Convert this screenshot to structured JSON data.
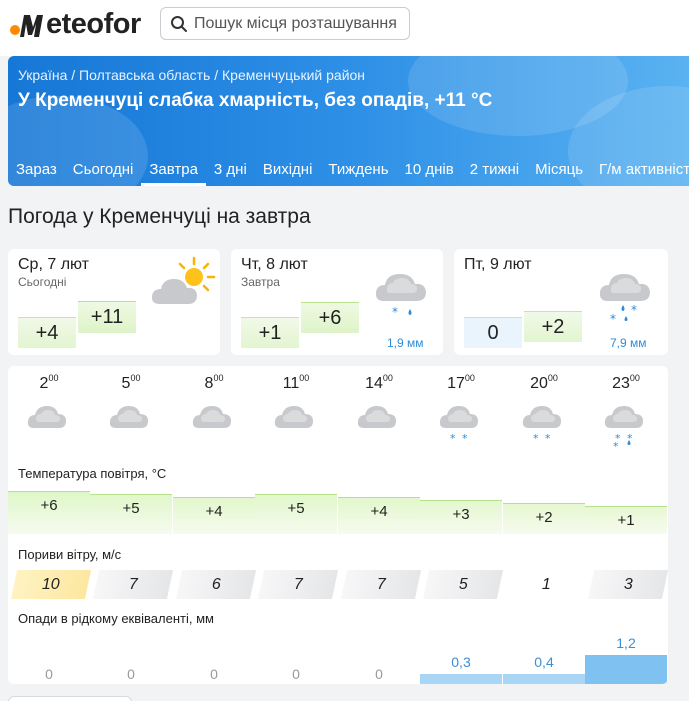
{
  "brand": {
    "name": "Meteofor",
    "logo_text": "eteofor",
    "logo_letter": "M"
  },
  "search": {
    "placeholder": "Пошук місця розташування"
  },
  "breadcrumb": [
    "Україна",
    "Полтавська область",
    "Кременчуцький район"
  ],
  "breadcrumb_sep": " / ",
  "hero_title": "У Кременчуці слабка хмарність, без опадів, +11 °C",
  "tabs": [
    "Зараз",
    "Сьогодні",
    "Завтра",
    "3 дні",
    "Вихідні",
    "Тиждень",
    "10 днів",
    "2 тижні",
    "Місяць",
    "Г/м активність"
  ],
  "active_tab": "Завтра",
  "page_title": "Погода у Кременчуці на завтра",
  "days": [
    {
      "date": "Ср, 7 лют",
      "sub": "Сьогодні",
      "min": "+4",
      "max": "+11",
      "icon": "partly-cloudy-icon",
      "precip": ""
    },
    {
      "date": "Чт, 8 лют",
      "sub": "Завтра",
      "min": "+1",
      "max": "+6",
      "icon": "cloud-snow-rain-icon",
      "precip": "1,9 мм"
    },
    {
      "date": "Пт, 9 лют",
      "sub": "",
      "min": "0",
      "max": "+2",
      "icon": "cloud-snow-rain-heavy-icon",
      "precip": "7,9 мм"
    }
  ],
  "hours": [
    "2",
    "5",
    "8",
    "11",
    "14",
    "17",
    "20",
    "23"
  ],
  "hours_suffix": "00",
  "hour_icons": [
    "cloud-icon",
    "cloud-icon",
    "cloud-icon",
    "cloud-icon",
    "cloud-icon",
    "cloud-snow-icon",
    "cloud-snow-icon",
    "cloud-snow-heavy-icon"
  ],
  "labels": {
    "temperature": "Температура повітря, °C",
    "wind": "Пориви вітру, м/с",
    "precip": "Опади в рідкому еквіваленті, мм"
  },
  "temperatures": [
    "+6",
    "+5",
    "+4",
    "+5",
    "+4",
    "+3",
    "+2",
    "+1"
  ],
  "wind_gusts": [
    "10",
    "7",
    "6",
    "7",
    "7",
    "5",
    "1",
    "3"
  ],
  "precipitation": [
    "0",
    "0",
    "0",
    "0",
    "0",
    "0,3",
    "0,4",
    "1,2"
  ],
  "colors": {
    "brand_orange": "#ff8a00",
    "hero_blue": "#1677d6",
    "temp_green": "#def4c8",
    "precip_blue": "#7fc2f1",
    "wind_yellow": "#fde7a0"
  }
}
